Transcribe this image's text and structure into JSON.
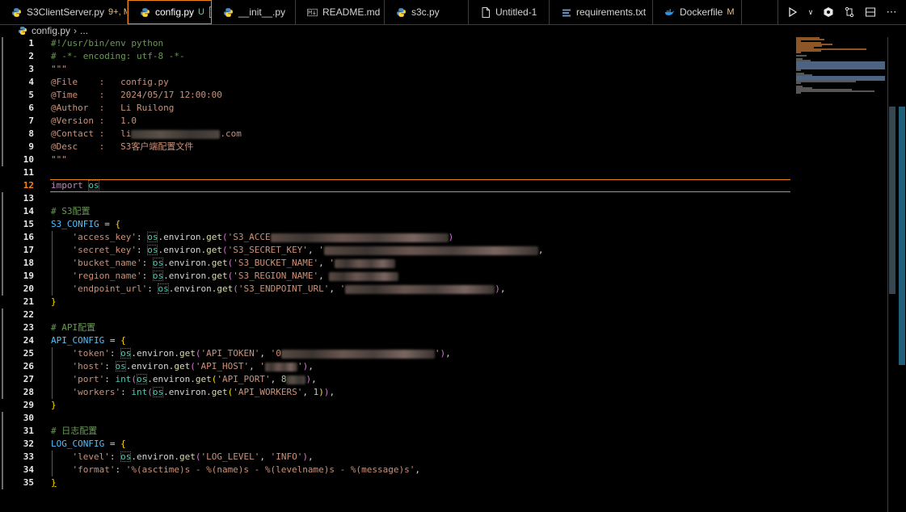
{
  "tabs": [
    {
      "label": "S3ClientServer.py",
      "badge": "9+, M",
      "icon": "python-icon",
      "active": false,
      "width": 158
    },
    {
      "label": "config.py",
      "badge": "U",
      "icon": "python-icon",
      "active": true,
      "width": 104
    },
    {
      "label": "__init__.py",
      "badge": "",
      "icon": "python-icon",
      "active": false,
      "width": 104
    },
    {
      "label": "README.md",
      "badge": "",
      "icon": "markdown-icon",
      "active": false,
      "width": 110
    },
    {
      "label": "s3c.py",
      "badge": "",
      "icon": "python-icon",
      "active": false,
      "width": 104
    },
    {
      "label": "Untitled-1",
      "badge": "",
      "icon": "file-icon",
      "active": false,
      "width": 100
    },
    {
      "label": "requirements.txt",
      "badge": "",
      "icon": "text-icon",
      "active": false,
      "width": 128
    },
    {
      "label": "Dockerfile",
      "badge": "M",
      "icon": "docker-icon",
      "active": false,
      "width": 110
    }
  ],
  "breadcrumb": {
    "file": "config.py",
    "more": "..."
  },
  "lines": [
    {
      "n": "1",
      "html": "<span class='c-comment'>#!/usr/bin/env python</span>"
    },
    {
      "n": "2",
      "html": "<span class='c-comment'># -*- encoding: utf-8 -*-</span>"
    },
    {
      "n": "3",
      "html": "<span class='c-str'>\"\"\"</span>"
    },
    {
      "n": "4",
      "html": "<span class='c-str'>@File    :   config.py</span>"
    },
    {
      "n": "5",
      "html": "<span class='c-str'>@Time    :   2024/05/17 12:00:00</span>"
    },
    {
      "n": "6",
      "html": "<span class='c-str'>@Author  :   Li Ruilong</span>"
    },
    {
      "n": "7",
      "html": "<span class='c-str'>@Version :   1.0</span>"
    },
    {
      "n": "8",
      "html": "<span class='c-str'>@Contact :   li</span><span class='blur s' style='width:110px'></span><span class='c-str'>.com</span>"
    },
    {
      "n": "9",
      "html": "<span class='c-str'>@Desc    :   S3客户端配置文件</span>"
    },
    {
      "n": "10",
      "html": "<span class='c-str'>\"\"\"</span>"
    },
    {
      "n": "11",
      "html": ""
    },
    {
      "n": "12",
      "html": "<span class='c-kw'>import</span> <span class='c-ent hl'>os</span>",
      "current": true
    },
    {
      "n": "13",
      "html": ""
    },
    {
      "n": "14",
      "html": "<span class='c-comment'># S3配置</span>"
    },
    {
      "n": "15",
      "html": "<span class='c-var'>S3_CONFIG</span> <span class='c-plain'>=</span> <span class='c-b1'>{</span>"
    },
    {
      "n": "16",
      "html": "    <span class='c-str'>'access_key'</span><span class='c-plain'>: </span><span class='c-ent hl'>os</span><span class='c-plain'>.environ.</span><span class='c-fn'>get</span><span class='c-b2'>(</span><span class='c-str'>'S3_ACCE</span><span class='blur' style='width:220px'></span><span class='c-b2'>)</span>"
    },
    {
      "n": "17",
      "html": "    <span class='c-str'>'secret_key'</span><span class='c-plain'>: </span><span class='c-ent hl'>os</span><span class='c-plain'>.environ.</span><span class='c-fn'>get</span><span class='c-b2'>(</span><span class='c-str'>'S3_SECRET_KEY'</span><span class='c-plain'>, </span><span class='c-str'>'</span><span class='blur' style='width:265px'></span><span class='c-plain'>,</span>"
    },
    {
      "n": "18",
      "html": "    <span class='c-str'>'bucket_name'</span><span class='c-plain'>: </span><span class='c-ent hl'>os</span><span class='c-plain'>.environ.</span><span class='c-fn'>get</span><span class='c-b2'>(</span><span class='c-str'>'S3_BUCKET_NAME'</span><span class='c-plain'>, </span><span class='c-str'>'</span><span class='blur' style='width:75px'></span>"
    },
    {
      "n": "19",
      "html": "    <span class='c-str'>'region_name'</span><span class='c-plain'>: </span><span class='c-ent hl'>os</span><span class='c-plain'>.environ.</span><span class='c-fn'>get</span><span class='c-b2'>(</span><span class='c-str'>'S3_REGION_NAME'</span><span class='c-plain'>, </span><span class='blur' style='width:86px'></span>"
    },
    {
      "n": "20",
      "html": "    <span class='c-str'>'endpoint_url'</span><span class='c-plain'>: </span><span class='c-ent hl'>os</span><span class='c-plain'>.environ.</span><span class='c-fn'>get</span><span class='c-b2'>(</span><span class='c-str'>'S3_ENDPOINT_URL'</span><span class='c-plain'>, </span><span class='c-str'>'</span><span class='blur' style='width:185px'></span><span class='c-b2'>)</span><span class='c-plain'>,</span>"
    },
    {
      "n": "21",
      "html": "<span class='c-b1'>}</span>"
    },
    {
      "n": "22",
      "html": ""
    },
    {
      "n": "23",
      "html": "<span class='c-comment'># API配置</span>"
    },
    {
      "n": "24",
      "html": "<span class='c-var'>API_CONFIG</span> <span class='c-plain'>=</span> <span class='c-b1'>{</span>"
    },
    {
      "n": "25",
      "html": "    <span class='c-str'>'token'</span><span class='c-plain'>: </span><span class='c-ent hl'>os</span><span class='c-plain'>.environ.</span><span class='c-fn'>get</span><span class='c-b2'>(</span><span class='c-str'>'API_TOKEN'</span><span class='c-plain'>, </span><span class='c-str'>'0</span><span class='blur' style='width:190px'></span><span class='c-str'>'</span><span class='c-b2'>)</span><span class='c-plain'>,</span>"
    },
    {
      "n": "26",
      "html": "    <span class='c-str'>'host'</span><span class='c-plain'>: </span><span class='c-ent hl'>os</span><span class='c-plain'>.environ.</span><span class='c-fn'>get</span><span class='c-b2'>(</span><span class='c-str'>'API_HOST'</span><span class='c-plain'>, </span><span class='c-str'>'</span><span class='blur' style='width:40px'></span><span class='c-str'>'</span><span class='c-b2'>)</span><span class='c-plain'>,</span>"
    },
    {
      "n": "27",
      "html": "    <span class='c-str'>'port'</span><span class='c-plain'>: </span><span class='c-ent'>int</span><span class='c-b2'>(</span><span class='c-ent hl'>os</span><span class='c-plain'>.environ.</span><span class='c-fn'>get</span><span class='c-b1'>(</span><span class='c-str'>'API_PORT'</span><span class='c-plain'>, </span><span class='c-num'>8</span><span class='blur s' style='width:24px'></span><span class='c-b2'>)</span><span class='c-plain'>,</span>"
    },
    {
      "n": "28",
      "html": "    <span class='c-str'>'workers'</span><span class='c-plain'>: </span><span class='c-ent'>int</span><span class='c-b2'>(</span><span class='c-ent hl'>os</span><span class='c-plain'>.environ.</span><span class='c-fn'>get</span><span class='c-b1'>(</span><span class='c-str'>'API_WORKERS'</span><span class='c-plain'>, </span><span class='c-num'>1</span><span class='c-b1'>)</span><span class='c-b2'>)</span><span class='c-plain'>,</span>"
    },
    {
      "n": "29",
      "html": "<span class='c-b1'>}</span>"
    },
    {
      "n": "30",
      "html": ""
    },
    {
      "n": "31",
      "html": "<span class='c-comment'># 日志配置</span>"
    },
    {
      "n": "32",
      "html": "<span class='c-var'>LOG_CONFIG</span> <span class='c-plain'>=</span> <span class='c-b1'>{</span>"
    },
    {
      "n": "33",
      "html": "    <span class='c-str'>'level'</span><span class='c-plain'>: </span><span class='c-ent hl'>os</span><span class='c-plain'>.environ.</span><span class='c-fn'>get</span><span class='c-b2'>(</span><span class='c-str'>'LOG_LEVEL'</span><span class='c-plain'>, </span><span class='c-str'>'INFO'</span><span class='c-b2'>)</span><span class='c-plain'>,</span>"
    },
    {
      "n": "34",
      "html": "    <span class='c-str'>'format'</span><span class='c-plain'>: </span><span class='c-str'>'%(asctime)s - %(name)s - %(levelname)s - %(message)s'</span><span class='c-plain'>,</span>"
    },
    {
      "n": "35",
      "html": "<span class='c-b1 ul'>}</span>"
    }
  ],
  "colors": {
    "accent": "#f38518",
    "background": "#000000",
    "comment": "#6a9955",
    "string": "#ce9178"
  }
}
